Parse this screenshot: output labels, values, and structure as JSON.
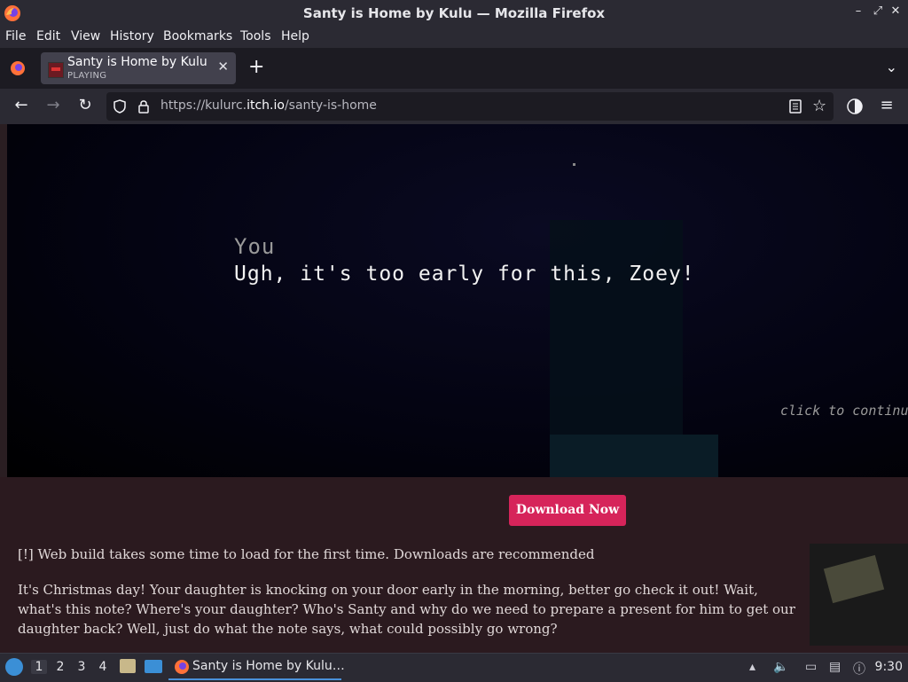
{
  "window": {
    "title": "Santy is Home by Kulu — Mozilla Firefox"
  },
  "menu": [
    "File",
    "Edit",
    "View",
    "History",
    "Bookmarks",
    "Tools",
    "Help"
  ],
  "tab": {
    "title": "Santy is Home by Kulu",
    "status": "PLAYING"
  },
  "url": {
    "prefix": "https://kulurc.",
    "domain": "itch.io",
    "path": "/santy-is-home"
  },
  "game": {
    "speaker": "You",
    "dialogue": "Ugh, it's too early for this, Zoey!",
    "continue_hint": "click to continue"
  },
  "page": {
    "download_button": "Download Now",
    "notice": "[!] Web build takes some time to load for the first time. Downloads are recommended",
    "description": "It's Christmas day! Your daughter is knocking on your door early in the morning, better go check it out! Wait, what's this note? Where's your daughter? Who's Santy and why do we need to prepare a present for him to get our daughter back? Well, just do what the note says, what could possibly go wrong?"
  },
  "taskbar": {
    "workspaces": [
      "1",
      "2",
      "3",
      "4"
    ],
    "active_app": "Santy is Home by Kulu…",
    "clock": "9:30"
  }
}
